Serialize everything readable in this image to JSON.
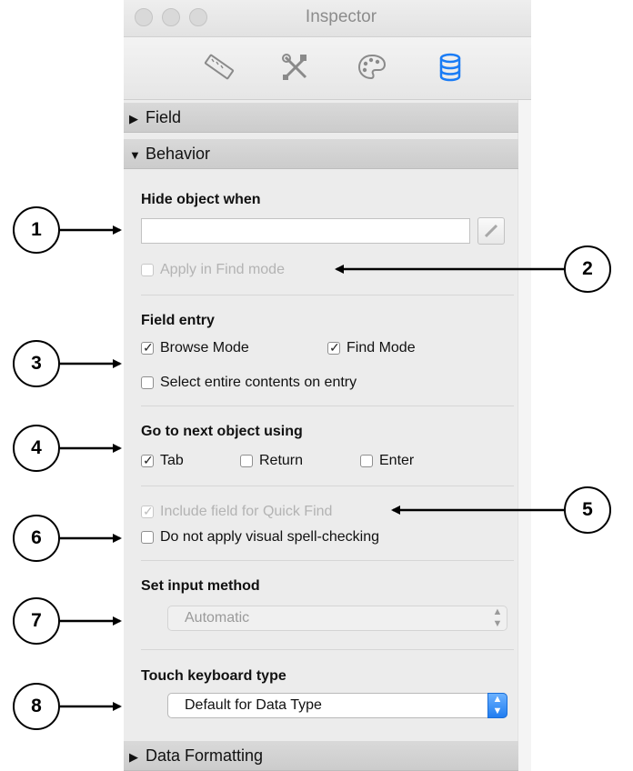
{
  "window": {
    "title": "Inspector"
  },
  "toolbar": {
    "tabs": [
      {
        "name": "position",
        "icon": "ruler-icon"
      },
      {
        "name": "styles",
        "icon": "tools-icon"
      },
      {
        "name": "appearance",
        "icon": "palette-icon"
      },
      {
        "name": "data",
        "icon": "database-icon",
        "selected": true
      }
    ]
  },
  "sections": {
    "field": {
      "label": "Field",
      "expanded": false
    },
    "behavior": {
      "label": "Behavior",
      "expanded": true
    },
    "data_formatting": {
      "label": "Data Formatting",
      "expanded": false
    }
  },
  "behavior": {
    "hide_object_when": {
      "label": "Hide object when",
      "value": ""
    },
    "apply_in_find_mode": {
      "label": "Apply in Find mode",
      "checked": false,
      "enabled": false
    },
    "field_entry": {
      "label": "Field entry",
      "browse_mode": {
        "label": "Browse Mode",
        "checked": true
      },
      "find_mode": {
        "label": "Find Mode",
        "checked": true
      },
      "select_entire_contents": {
        "label": "Select entire contents on entry",
        "checked": false
      }
    },
    "go_to_next": {
      "label": "Go to next object using",
      "tab": {
        "label": "Tab",
        "checked": true
      },
      "return": {
        "label": "Return",
        "checked": false
      },
      "enter": {
        "label": "Enter",
        "checked": false
      }
    },
    "include_quick_find": {
      "label": "Include field for Quick Find",
      "checked": true,
      "enabled": false
    },
    "no_spell_check": {
      "label": "Do not apply visual spell-checking",
      "checked": false
    },
    "input_method": {
      "label": "Set input method",
      "value": "Automatic",
      "enabled": false
    },
    "keyboard_type": {
      "label": "Touch keyboard type",
      "value": "Default for Data Type",
      "enabled": true
    }
  },
  "callouts": [
    "1",
    "2",
    "3",
    "4",
    "5",
    "6",
    "7",
    "8"
  ],
  "colors": {
    "accent": "#1f7cf0",
    "database_icon": "#1a7cf5",
    "section_header": "#d3d3d3"
  }
}
